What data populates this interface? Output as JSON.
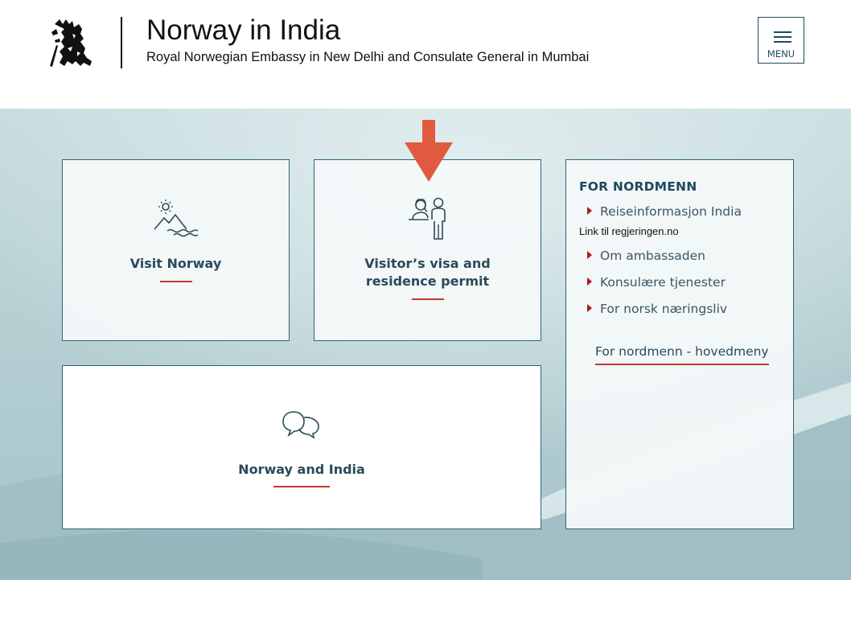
{
  "header": {
    "title": "Norway in India",
    "subtitle": "Royal Norwegian Embassy in New Delhi and Consulate General in Mumbai",
    "logo_icon": "norwegian-lion-coat-of-arms-icon",
    "menu_label": "MENU"
  },
  "cards": {
    "visit": {
      "label": "Visit Norway",
      "icon": "mountains-sun-icon"
    },
    "visa": {
      "label": "Visitor’s visa and residence permit",
      "icon": "visa-applicant-icon"
    },
    "norway_india": {
      "label": "Norway and India",
      "icon": "speech-bubbles-icon"
    }
  },
  "sidebar": {
    "heading": "FOR NORDMENN",
    "items": [
      {
        "label": "Reiseinformasjon India"
      },
      {
        "label": "Om ambassaden"
      },
      {
        "label": "Konsulære tjenester"
      },
      {
        "label": "For norsk næringsliv"
      }
    ],
    "link_note": "Link til regjeringen.no",
    "main_link": "For nordmenn - hovedmeny"
  },
  "colors": {
    "accent": "#c0392b",
    "arrow": "#e05a3f",
    "brand": "#1d4a5c"
  }
}
